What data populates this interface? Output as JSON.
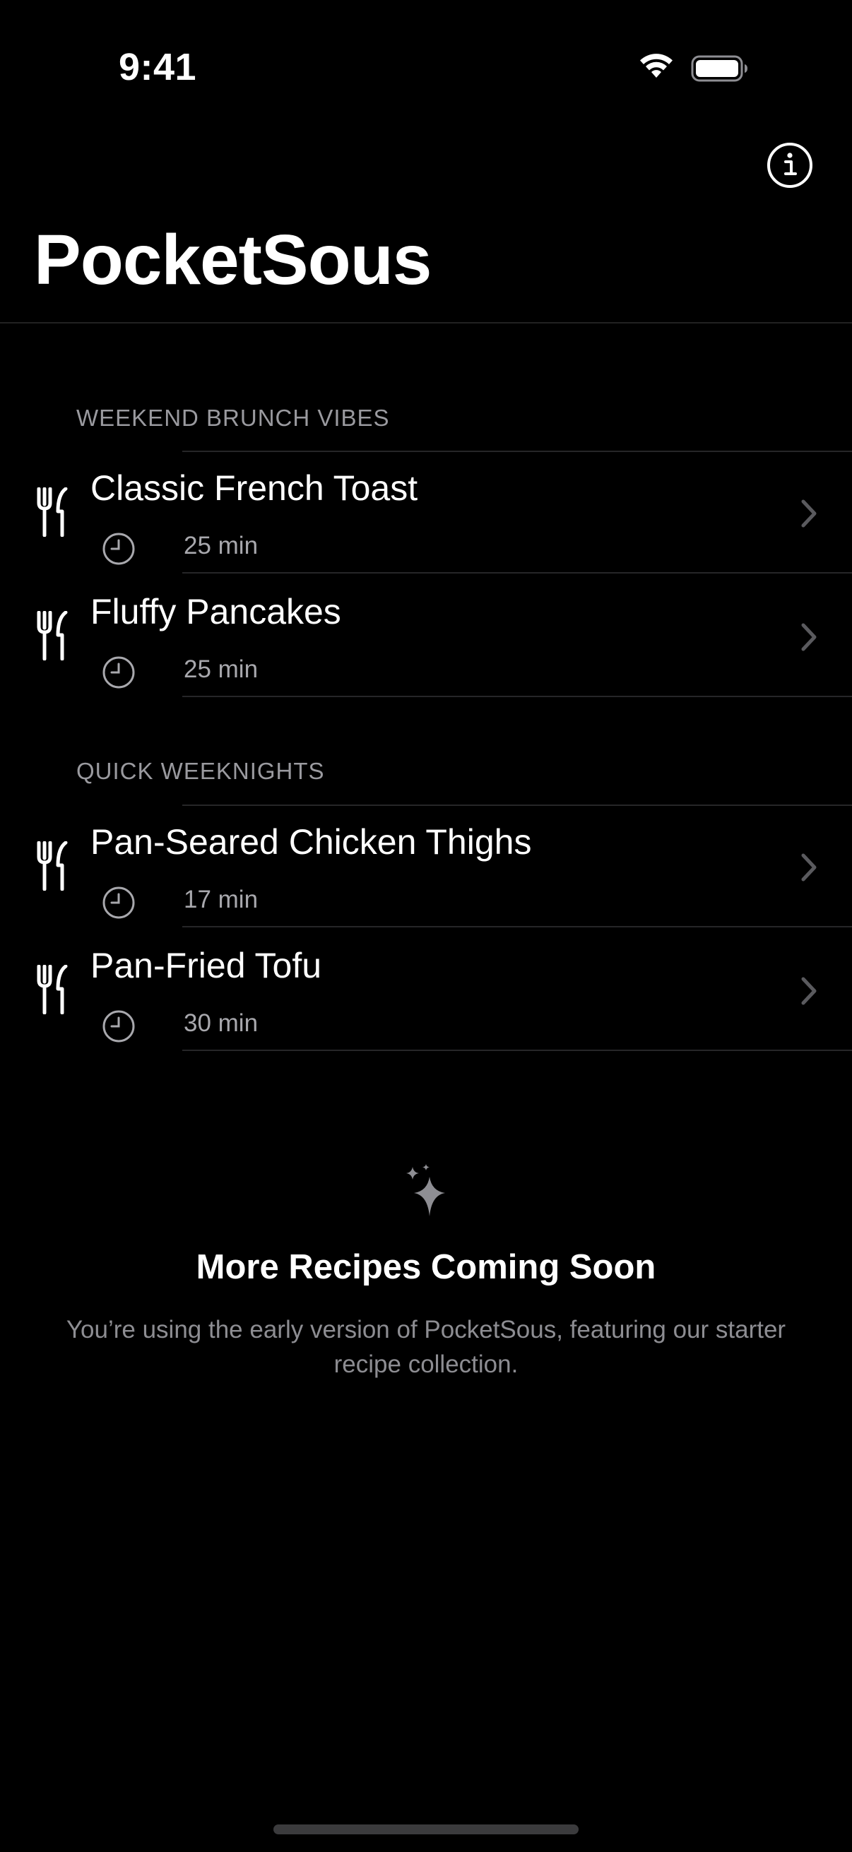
{
  "status_bar": {
    "time": "9:41"
  },
  "header": {
    "title": "PocketSous",
    "info_icon": "info-circle-icon"
  },
  "sections": [
    {
      "header": "WEEKEND BRUNCH VIBES",
      "rows": [
        {
          "title": "Classic French Toast",
          "time": "25 min"
        },
        {
          "title": "Fluffy Pancakes",
          "time": "25 min"
        }
      ]
    },
    {
      "header": "QUICK WEEKNIGHTS",
      "rows": [
        {
          "title": "Pan-Seared Chicken Thighs",
          "time": "17 min"
        },
        {
          "title": "Pan-Fried Tofu",
          "time": "30 min"
        }
      ]
    }
  ],
  "footer": {
    "icon": "sparkles-icon",
    "title": "More Recipes Coming Soon",
    "body": "You’re using the early version of PocketSous, featuring our starter recipe collection."
  },
  "colors": {
    "background": "#000000",
    "text_primary": "#ffffff",
    "text_secondary": "#a8a8ad",
    "separator": "#262628",
    "chevron": "#5a5a5e"
  }
}
